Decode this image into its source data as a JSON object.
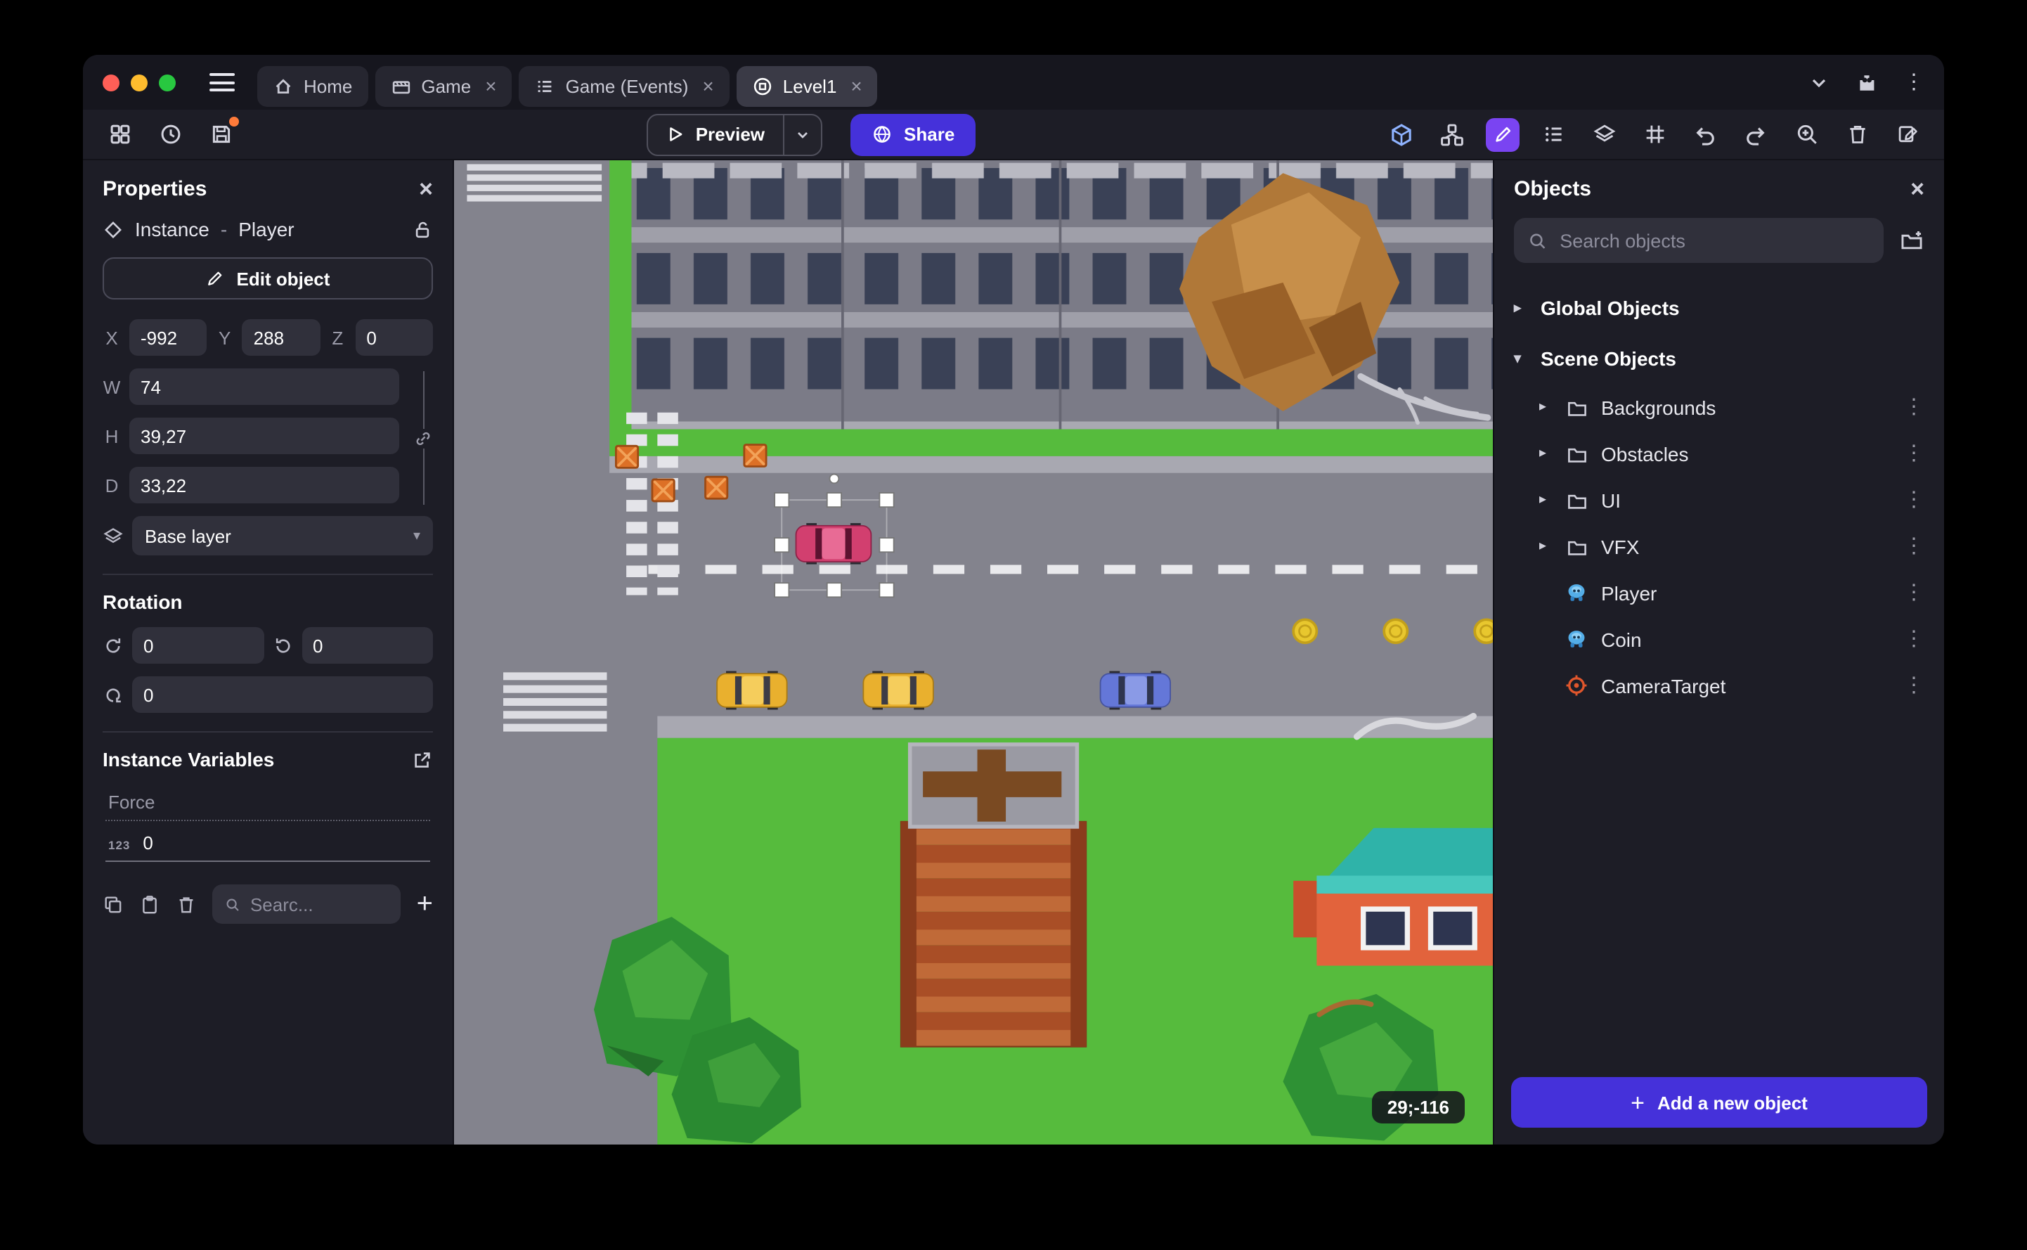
{
  "titlebar": {
    "tabs": [
      {
        "label": "Home"
      },
      {
        "label": "Game"
      },
      {
        "label": "Game (Events)"
      },
      {
        "label": "Level1"
      }
    ]
  },
  "toolbar": {
    "preview": "Preview",
    "share": "Share"
  },
  "properties": {
    "title": "Properties",
    "instance_label": "Instance",
    "dash": "-",
    "object_name": "Player",
    "edit_object": "Edit object",
    "x_label": "X",
    "x": "-992",
    "y_label": "Y",
    "y": "288",
    "z_label": "Z",
    "z": "0",
    "w_label": "W",
    "w": "74",
    "h_label": "H",
    "h": "39,27",
    "d_label": "D",
    "d": "33,22",
    "layer": "Base layer",
    "rotation_title": "Rotation",
    "rot_x": "0",
    "rot_y": "0",
    "rot_z": "0",
    "variables_title": "Instance Variables",
    "variable_name": "Force",
    "variable_type": "123",
    "variable_value": "0",
    "search_placeholder": "Searc..."
  },
  "canvas": {
    "coords_badge": "29;-116"
  },
  "objects": {
    "title": "Objects",
    "search_placeholder": "Search objects",
    "global_section": "Global Objects",
    "scene_section": "Scene Objects",
    "folders": [
      "Backgrounds",
      "Obstacles",
      "UI",
      "VFX"
    ],
    "items": [
      "Player",
      "Coin",
      "CameraTarget"
    ],
    "add_button": "Add a new object"
  },
  "colors": {
    "accent_purple": "#4531da",
    "toolbar_pencil_bg": "#7a44f2",
    "grass_green": "#56bb3d",
    "player_car_pink": "#d23f6f",
    "coin_yellow": "#e8c72e"
  }
}
